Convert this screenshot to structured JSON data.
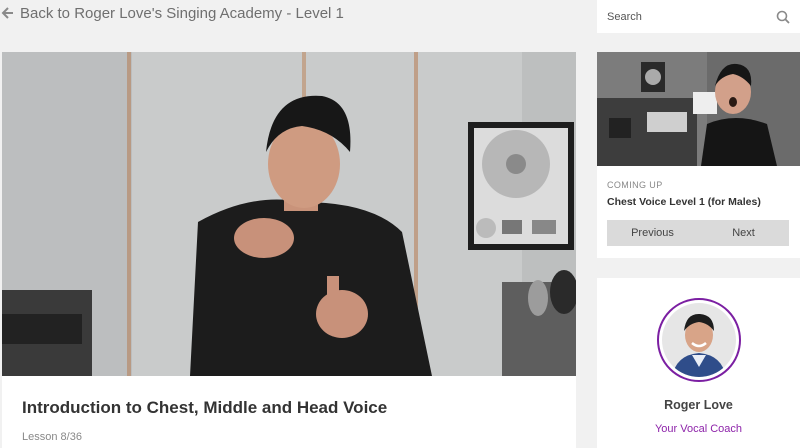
{
  "header": {
    "back_label": "Back to Roger Love's Singing Academy - Level 1"
  },
  "search": {
    "placeholder": "Search",
    "icon": "search-icon"
  },
  "lesson": {
    "title": "Introduction to Chest, Middle and Head Voice",
    "count": "Lesson 8/36"
  },
  "up_next": {
    "label": "COMING UP",
    "title": "Chest Voice Level 1 (for Males)",
    "previous_label": "Previous",
    "next_label": "Next"
  },
  "coach": {
    "name": "Roger Love",
    "role": "Your Vocal Coach",
    "accent_color": "#8e24aa"
  }
}
